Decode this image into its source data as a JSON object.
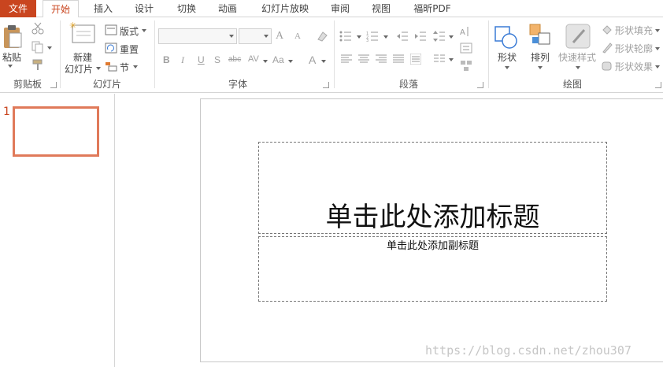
{
  "tabs": [
    {
      "label": "文件",
      "kind": "file"
    },
    {
      "label": "开始",
      "kind": "active"
    },
    {
      "label": "插入",
      "kind": "normal"
    },
    {
      "label": "设计",
      "kind": "normal"
    },
    {
      "label": "切换",
      "kind": "normal"
    },
    {
      "label": "动画",
      "kind": "normal"
    },
    {
      "label": "幻灯片放映",
      "kind": "normal"
    },
    {
      "label": "审阅",
      "kind": "normal"
    },
    {
      "label": "视图",
      "kind": "normal"
    },
    {
      "label": "福昕PDF",
      "kind": "normal"
    }
  ],
  "colors": {
    "accent": "#c9451f",
    "thumb_border": "#e07a5a",
    "watermark": "#c6c6c6"
  },
  "ribbon": {
    "clipboard": {
      "paste_label": "粘贴",
      "group_label": "剪贴板"
    },
    "slides": {
      "new_slide_line1": "新建",
      "new_slide_line2": "幻灯片",
      "layout_label": "版式",
      "reset_label": "重置",
      "section_label": "节",
      "group_label": "幻灯片"
    },
    "font": {
      "group_label": "字体",
      "bold": "B",
      "italic": "I",
      "underline": "U",
      "shadow": "S",
      "strike": "abc",
      "spacing": "AV",
      "case": "Aa",
      "color": "A",
      "grow": "A",
      "shrink": "A"
    },
    "paragraph": {
      "group_label": "段落"
    },
    "drawing": {
      "group_label": "绘图",
      "shapes_label": "形状",
      "arrange_label": "排列",
      "quick_styles_label": "快速样式",
      "shape_fill": "形状填充",
      "shape_outline": "形状轮廓",
      "shape_effects": "形状效果"
    }
  },
  "thumbnails": [
    {
      "number": "1"
    }
  ],
  "slide": {
    "title_placeholder": "单击此处添加标题",
    "subtitle_placeholder": "单击此处添加副标题"
  },
  "watermark": "https://blog.csdn.net/zhou307"
}
